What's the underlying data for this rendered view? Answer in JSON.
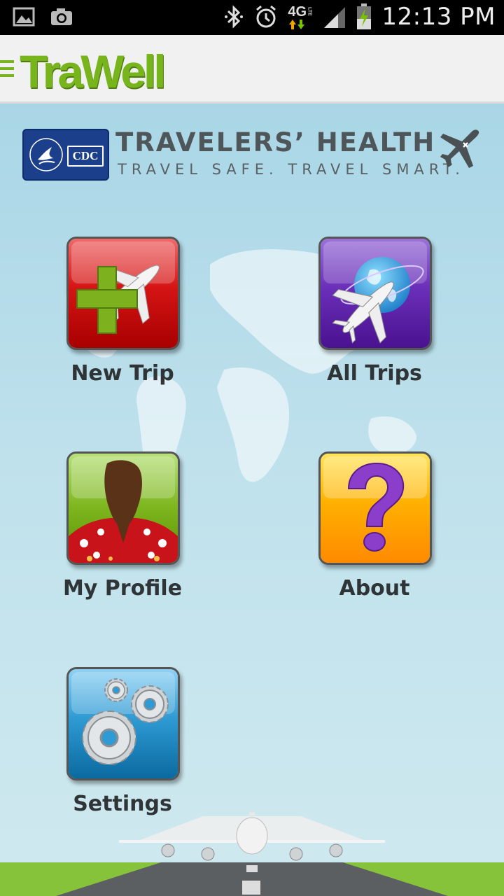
{
  "status_bar": {
    "network": "4G",
    "network_sub": "LTE",
    "time": "12:13 PM",
    "icons": [
      "gallery-icon",
      "camera-icon",
      "bluetooth-icon",
      "alarm-icon",
      "data-arrows-icon",
      "signal-icon",
      "battery-charging-icon"
    ]
  },
  "app_bar": {
    "logo": "TraWell",
    "menu_icon": "hamburger-icon"
  },
  "header": {
    "cdc_badge": "CDC",
    "title": "TRAVELERS’ HEALTH",
    "tagline": "TRAVEL SAFE. TRAVEL SMART."
  },
  "tiles": [
    {
      "label": "New Trip",
      "icon": "new-trip-icon"
    },
    {
      "label": "All Trips",
      "icon": "all-trips-icon"
    },
    {
      "label": "My Profile",
      "icon": "profile-icon"
    },
    {
      "label": "About",
      "icon": "question-mark-icon"
    },
    {
      "label": "Settings",
      "icon": "gears-icon"
    }
  ],
  "colors": {
    "brand_green": "#78b51d",
    "background_blue": "#bfe1ec",
    "cdc_blue": "#1b3f8b"
  }
}
